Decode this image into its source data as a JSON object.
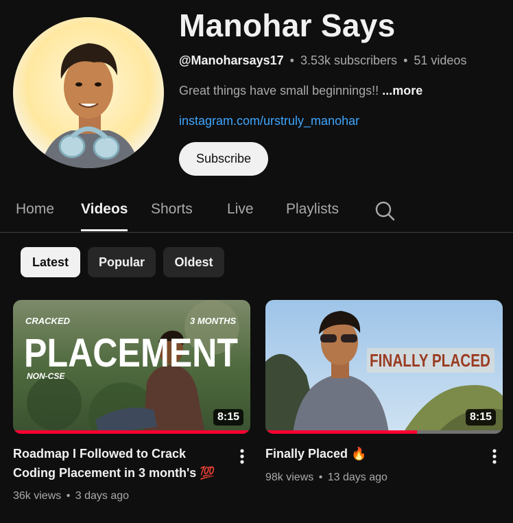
{
  "channel": {
    "name": "Manohar Says",
    "handle": "@Manoharsays17",
    "subscribers": "3.53k subscribers",
    "videos_count": "51 videos",
    "separator": "•",
    "description": "Great things have small beginnings!!",
    "more_label": "...more",
    "link": "instagram.com/urstruly_manohar",
    "subscribe_label": "Subscribe"
  },
  "tabs": [
    {
      "label": "Home",
      "active": false
    },
    {
      "label": "Videos",
      "active": true
    },
    {
      "label": "Shorts",
      "active": false
    },
    {
      "label": "Live",
      "active": false
    },
    {
      "label": "Playlists",
      "active": false
    }
  ],
  "search_icon": "search-icon",
  "chips": [
    {
      "label": "Latest",
      "active": true
    },
    {
      "label": "Popular",
      "active": false
    },
    {
      "label": "Oldest",
      "active": false
    }
  ],
  "videos": [
    {
      "title_line1": "Roadmap I Followed to Crack",
      "title_line2": "Coding Placement in 3 month's 💯",
      "views": "36k views",
      "age": "3 days ago",
      "duration": "8:15",
      "watched_fraction": 1.0,
      "thumb_text": {
        "top_left": "CRACKED",
        "top_right": "3 MONTHS",
        "big": "PLACEMENT",
        "bottom_left": "NON-CSE"
      }
    },
    {
      "title_line1": "Finally Placed 🔥",
      "views": "98k views",
      "age": "13 days ago",
      "duration": "8:15",
      "watched_fraction": 0.64,
      "thumb_text": {
        "banner": "FINALLY PLACED"
      }
    }
  ],
  "colors": {
    "background": "#0f0f0f",
    "link": "#3ea6ff",
    "progress": "#ff0033"
  }
}
